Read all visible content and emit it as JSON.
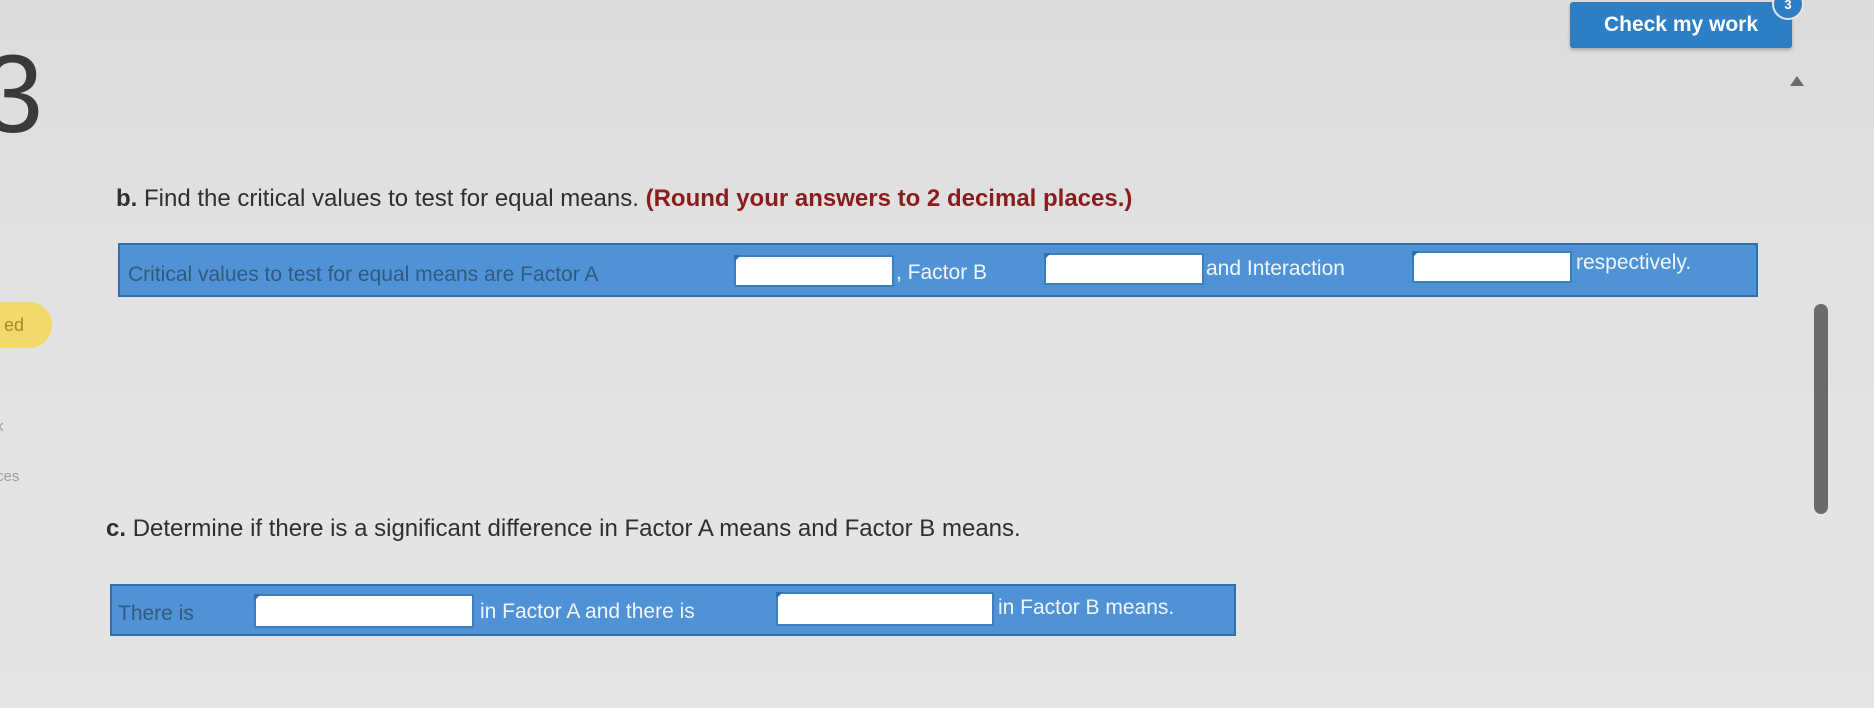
{
  "sidebar": {
    "question_number": "3",
    "status_pill": "ed",
    "fragment_1": "k",
    "fragment_2": "ces"
  },
  "header": {
    "check_button_label": "Check my work",
    "check_badge": "3"
  },
  "part_b": {
    "letter": "b.",
    "prompt": "Find the critical values to test for equal means.",
    "hint": "(Round your answers to 2 decimal places.)",
    "label_1": "Critical values to test for equal means are Factor A",
    "label_2": ", Factor B",
    "label_3": "and Interaction",
    "label_4": "respectively.",
    "input_factor_a": "",
    "input_factor_b": "",
    "input_interaction": ""
  },
  "part_c": {
    "letter": "c.",
    "prompt": "Determine if there is a significant difference in Factor A means and Factor B means.",
    "label_1": "There is",
    "label_2": "in Factor A and there is",
    "label_3": "in Factor B means.",
    "select_factor_a": "",
    "select_factor_b": ""
  },
  "colors": {
    "strip_blue": "#4f93d6",
    "button_blue": "#2d7ec4",
    "hint_red": "#8b1c1c"
  }
}
